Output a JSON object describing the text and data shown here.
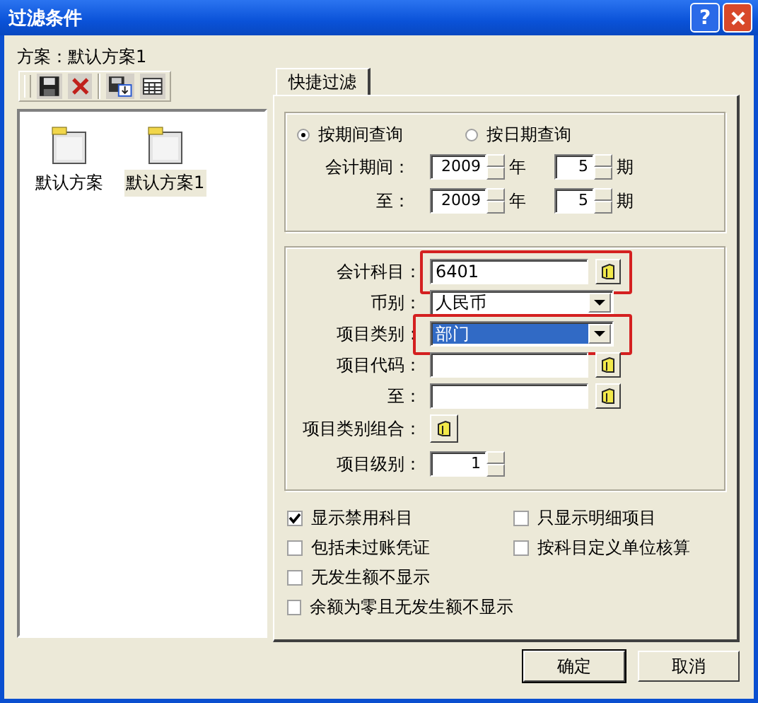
{
  "window": {
    "title": "过滤条件",
    "help": "?"
  },
  "scheme_label": "方案：默认方案1",
  "schemes": [
    {
      "label": "默认方案",
      "selected": false
    },
    {
      "label": "默认方案1",
      "selected": true
    }
  ],
  "tabs": [
    {
      "label": "快捷过滤",
      "selected": true
    }
  ],
  "period_modes": [
    {
      "label": "按期间查询",
      "selected": true
    },
    {
      "label": "按日期查询",
      "selected": false
    }
  ],
  "period_rows": [
    {
      "label": "会计期间：",
      "year": "2009",
      "year_unit": "年",
      "period": "5",
      "period_unit": "期"
    },
    {
      "label": "至：",
      "year": "2009",
      "year_unit": "年",
      "period": "5",
      "period_unit": "期"
    }
  ],
  "fields": [
    {
      "kind": "lookup",
      "label": "会计科目：",
      "value": "6401",
      "highlighted": true,
      "focused": false
    },
    {
      "kind": "dropdown",
      "label": "币别：",
      "value": "人民币",
      "highlighted": false,
      "focused": false
    },
    {
      "kind": "dropdown",
      "label": "项目类别：",
      "value": "部门",
      "highlighted": true,
      "focused": true
    },
    {
      "kind": "lookup",
      "label": "项目代码：",
      "highlighted": false,
      "focused": false
    },
    {
      "kind": "lookup",
      "label": "至：",
      "highlighted": false,
      "focused": false
    },
    {
      "kind": "button",
      "label": "项目类别组合：",
      "highlighted": false,
      "focused": false
    },
    {
      "kind": "spinner",
      "label": "项目级别：",
      "value": "1",
      "highlighted": false,
      "focused": false
    }
  ],
  "options_left": [
    {
      "label": "显示禁用科目",
      "checked": true
    },
    {
      "label": "包括未过账凭证",
      "checked": false
    },
    {
      "label": "无发生额不显示",
      "checked": false
    },
    {
      "label": "余额为零且无发生额不显示",
      "checked": false
    }
  ],
  "options_right": [
    {
      "label": "只显示明细项目",
      "checked": false
    },
    {
      "label": "按科目定义单位核算",
      "checked": false
    }
  ],
  "buttons": [
    "确定",
    "取消"
  ]
}
